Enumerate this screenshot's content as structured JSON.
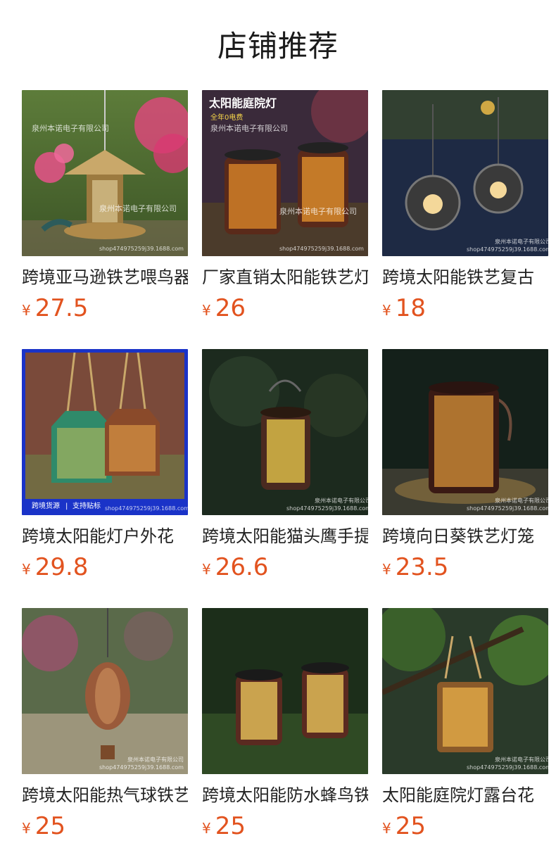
{
  "header": {
    "title": "店铺推荐"
  },
  "currency_symbol": "¥",
  "products": [
    {
      "title": "跨境亚马逊铁艺喂鸟器",
      "price": "27.5",
      "image_text": [
        "泉州本诺电子有限公司",
        "泉州本诺电子有限公司",
        "shop474975259j39.1688.com"
      ]
    },
    {
      "title": "厂家直销太阳能铁艺灯",
      "price": "26",
      "image_text": [
        "太阳能庭院灯",
        "全年0电费",
        "泉州本诺电子有限公司",
        "泉州本诺电子有限公司",
        "shop474975259j39.1688.com"
      ]
    },
    {
      "title": "跨境太阳能铁艺复古",
      "price": "18",
      "image_text": [
        "泉州本诺电子有限公司",
        "shop474975259j39.1688.com"
      ]
    },
    {
      "title": "跨境太阳能灯户外花",
      "price": "29.8",
      "image_text": [
        "跨境货源",
        "支持贴标",
        "shop474975259j39.1688.com"
      ]
    },
    {
      "title": "跨境太阳能猫头鹰手提",
      "price": "26.6",
      "image_text": [
        "泉州本诺电子有限公司",
        "shop474975259j39.1688.com"
      ]
    },
    {
      "title": "跨境向日葵铁艺灯笼",
      "price": "23.5",
      "image_text": [
        "泉州本诺电子有限公司",
        "shop474975259j39.1688.com"
      ]
    },
    {
      "title": "跨境太阳能热气球铁艺",
      "price": "25",
      "image_text": [
        "泉州本诺电子有限公司",
        "shop474975259j39.1688.com"
      ]
    },
    {
      "title": "跨境太阳能防水蜂鸟铁",
      "price": "25",
      "image_text": []
    },
    {
      "title": "太阳能庭院灯露台花",
      "price": "25",
      "image_text": [
        "泉州本诺电子有限公司",
        "shop474975259j39.1688.com"
      ]
    }
  ],
  "colors": {
    "price": "#e2531f",
    "title_text": "#222222",
    "background": "#ffffff"
  }
}
